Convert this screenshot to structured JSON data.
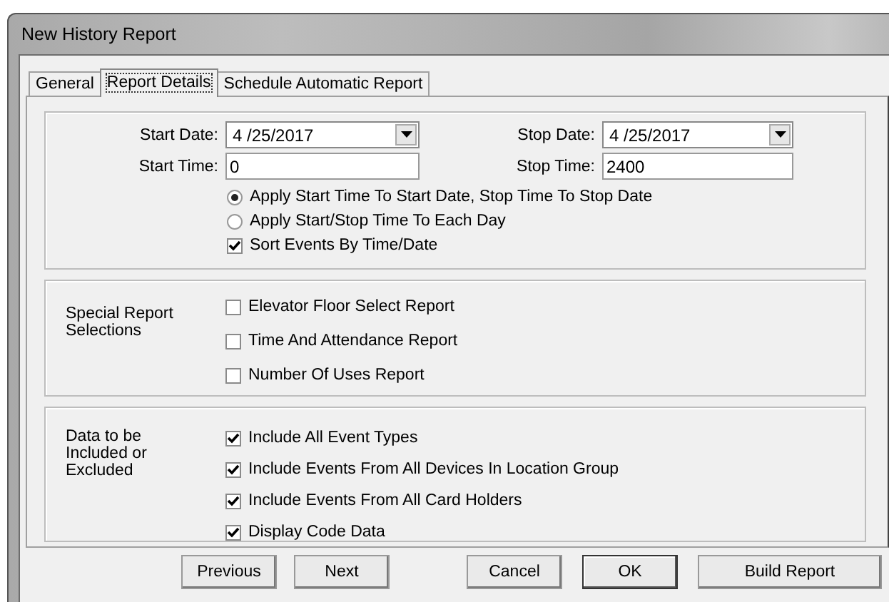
{
  "window": {
    "title": "New History Report"
  },
  "tabs": [
    {
      "label": "General",
      "selected": false
    },
    {
      "label": "Report Details",
      "selected": true
    },
    {
      "label": "Schedule Automatic Report",
      "selected": false
    }
  ],
  "date_range": {
    "start_date": {
      "label": "Start Date:",
      "value": "4 /25/2017"
    },
    "stop_date": {
      "label": "Stop Date:",
      "value": "4 /25/2017"
    },
    "start_time": {
      "label": "Start Time:",
      "value": "0"
    },
    "stop_time": {
      "label": "Stop Time:",
      "value": "2400"
    },
    "options": [
      {
        "kind": "radio",
        "label": "Apply Start Time To Start Date, Stop Time To Stop Date",
        "selected": true
      },
      {
        "kind": "radio",
        "label": "Apply Start/Stop Time To Each Day",
        "selected": false
      },
      {
        "kind": "checkbox",
        "label": "Sort Events By Time/Date",
        "checked": true
      }
    ]
  },
  "special_report_selections": {
    "label": "Special Report Selections",
    "options": [
      {
        "label": "Elevator Floor Select Report",
        "checked": false
      },
      {
        "label": "Time And Attendance Report",
        "checked": false
      },
      {
        "label": "Number Of Uses Report",
        "checked": false
      }
    ]
  },
  "data_inclusion": {
    "label": "Data to be Included or Excluded",
    "options": [
      {
        "label": "Include All Event Types",
        "checked": true
      },
      {
        "label": "Include Events From All Devices In Location Group",
        "checked": true
      },
      {
        "label": "Include Events From All Card Holders",
        "checked": true
      },
      {
        "label": "Display Code Data",
        "checked": true
      }
    ]
  },
  "buttons": [
    {
      "label": "Previous",
      "default": false
    },
    {
      "label": "Next",
      "default": false
    },
    {
      "label": "Cancel",
      "default": false
    },
    {
      "label": "OK",
      "default": true
    },
    {
      "label": "Build Report",
      "default": false
    }
  ]
}
